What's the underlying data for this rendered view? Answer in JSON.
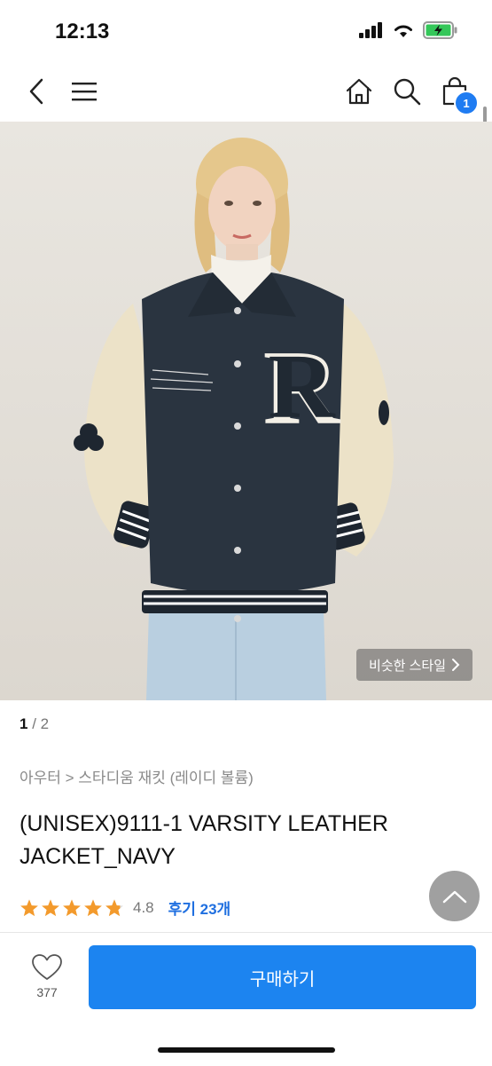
{
  "status": {
    "time": "12:13"
  },
  "nav": {
    "cart_count": "1"
  },
  "hero": {
    "similar_style_label": "비슷한 스타일"
  },
  "pager": {
    "current": "1",
    "separator": " / ",
    "total": "2"
  },
  "product": {
    "breadcrumb": "아우터 > 스타디움 재킷 (레이디 볼륨)",
    "title": "(UNISEX)9111-1 VARSITY LEATHER JACKET_NAVY",
    "rating": "4.8",
    "reviews": "후기 23개"
  },
  "bottom": {
    "like_count": "377",
    "buy_label": "구매하기"
  },
  "colors": {
    "accent": "#1c84f0",
    "star": "#f39a2c"
  }
}
